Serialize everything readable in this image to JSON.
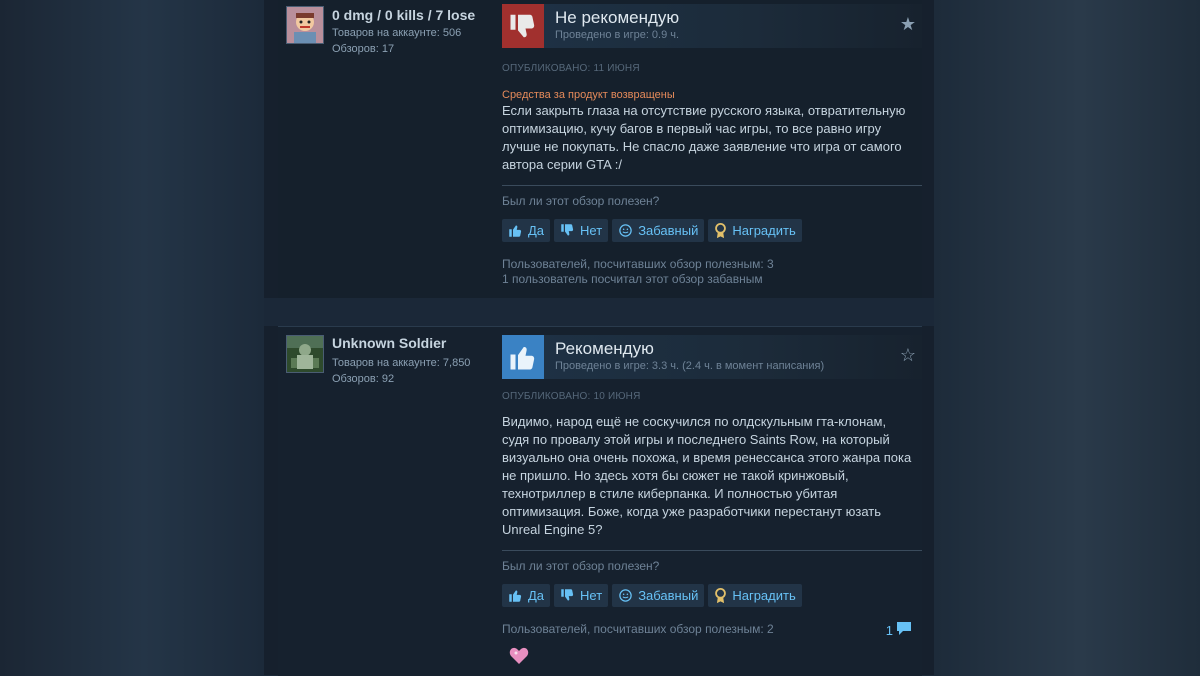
{
  "reviews": [
    {
      "author": {
        "name": "0 dmg / 0 kills / 7 lose",
        "products": "Товаров на аккаунте: 506",
        "reviews": "Обзоров: 17"
      },
      "verdict": {
        "title": "Не рекомендую",
        "hours": "Проведено в игре: 0.9 ч.",
        "type": "thumbs-down-icon",
        "color": "#a1302e"
      },
      "posted": "ОПУБЛИКОВАНО: 11 ИЮНЯ",
      "refund_note": "Средства за продукт возвращены",
      "body": "Если закрыть глаза на отсутствие русского языка, отвратительную оптимизацию, кучу багов в первый час игры, то все равно игру лучше не покупать. Не спасло даже заявление что игра от самого автора серии GTA :/",
      "helpful_question": "Был ли этот обзор полезен?",
      "buttons": {
        "yes": "Да",
        "no": "Нет",
        "funny": "Забавный",
        "award": "Наградить"
      },
      "stats": [
        "Пользователей, посчитавших обзор полезным: 3",
        "1 пользователь посчитал этот обзор забавным"
      ]
    },
    {
      "author": {
        "name": "Unknown Soldier",
        "products": "Товаров на аккаунте: 7,850",
        "reviews": "Обзоров: 92"
      },
      "verdict": {
        "title": "Рекомендую",
        "hours": "Проведено в игре: 3.3 ч. (2.4 ч. в момент написания)",
        "type": "thumbs-up-icon",
        "color": "#3a82c4"
      },
      "posted": "ОПУБЛИКОВАНО: 10 ИЮНЯ",
      "body": "Видимо, народ ещё не соскучился по олдскульным гта-клонам, судя по провалу этой игры и последнего Saints Row, на который визуально она очень похожа, и время ренессанса этого жанра пока не пришло. Но здесь хотя бы сюжет не такой кринжовый, технотриллер в стиле киберпанка. И полностью убитая оптимизация. Боже, когда уже разработчики перестанут юзать Unreal Engine 5?",
      "helpful_question": "Был ли этот обзор полезен?",
      "buttons": {
        "yes": "Да",
        "no": "Нет",
        "funny": "Забавный",
        "award": "Наградить"
      },
      "stats": [
        "Пользователей, посчитавших обзор полезным: 2"
      ],
      "comments": "1"
    }
  ],
  "colors": {
    "link": "#67c1f5",
    "text": "#c6d4df",
    "muted": "#6e8296",
    "refund": "#e58a5a"
  }
}
